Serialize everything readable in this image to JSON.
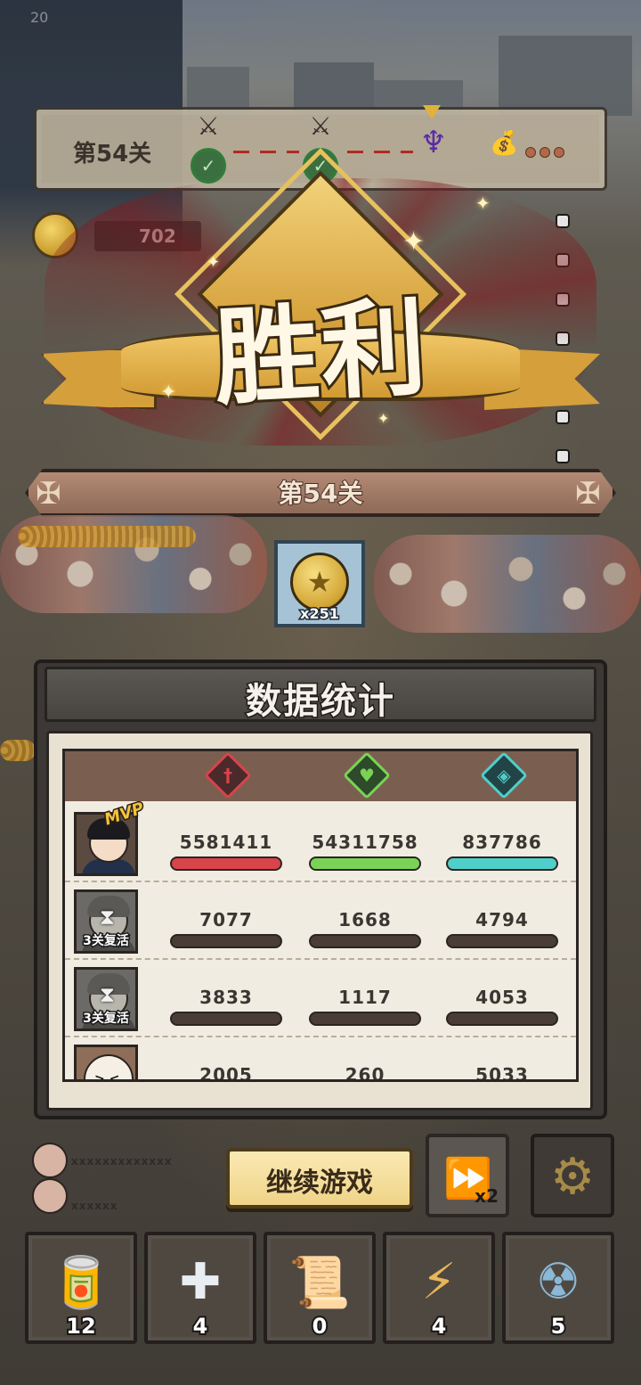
{
  "status": {
    "counter": "20"
  },
  "stage_progress": {
    "label": "第54关",
    "cleared_nodes": 2,
    "boss_icon": "demon-horns-icon",
    "reward_icon": "money-bag-icon",
    "remaining_dots": 3
  },
  "currency": {
    "coin_count": "702"
  },
  "victory": {
    "title": "胜利",
    "stage_label": "第54关"
  },
  "reward": {
    "icon": "star-coin-icon",
    "quantity": "x251"
  },
  "stats": {
    "title": "数据统计",
    "columns": [
      {
        "icon": "sword-icon",
        "color": "#d9434a"
      },
      {
        "icon": "heart-plus-icon",
        "color": "#7ad356"
      },
      {
        "icon": "shield-icon",
        "color": "#4fcfc9"
      }
    ],
    "rows": [
      {
        "badge": "MVP",
        "revive": "",
        "damage": "5581411",
        "healing": "54311758",
        "shield": "837786",
        "fills": [
          1.0,
          1.0,
          1.0
        ]
      },
      {
        "badge": "",
        "revive": "3关复活",
        "damage": "7077",
        "healing": "1668",
        "shield": "4794",
        "fills": [
          0,
          0,
          0
        ]
      },
      {
        "badge": "",
        "revive": "3关复活",
        "damage": "3833",
        "healing": "1117",
        "shield": "4053",
        "fills": [
          0,
          0,
          0
        ]
      },
      {
        "badge": "",
        "revive": "",
        "damage": "2005",
        "healing": "260",
        "shield": "5033",
        "fills": [
          0,
          0,
          0
        ]
      }
    ]
  },
  "actions": {
    "continue_label": "继续游戏",
    "speed_label": "x2"
  },
  "players": [
    {
      "name": "xxxxxxxxxxxxx"
    },
    {
      "name": "xxxxxx"
    }
  ],
  "items": [
    {
      "icon": "cola-can-icon",
      "count": "12"
    },
    {
      "icon": "first-aid-kit-icon",
      "count": "4"
    },
    {
      "icon": "scroll-icon",
      "count": "0"
    },
    {
      "icon": "lightning-paper-icon",
      "count": "4"
    },
    {
      "icon": "nuclear-bomb-icon",
      "count": "5"
    }
  ]
}
